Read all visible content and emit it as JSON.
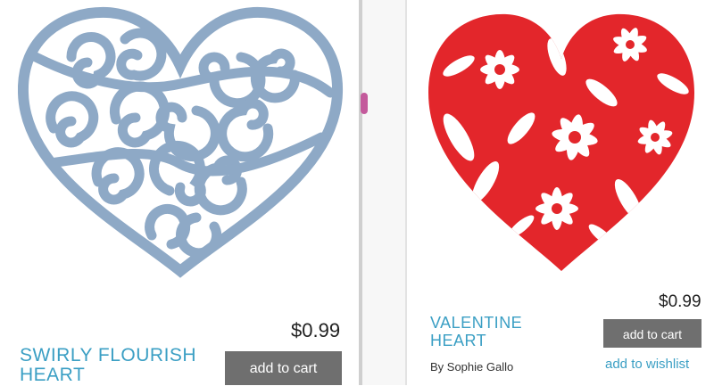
{
  "products": [
    {
      "title": "SWIRLY FLOURISH HEART",
      "price": "$0.99",
      "add_to_cart_label": "add to cart",
      "image_icon": "swirly-heart-icon",
      "color": "#8ea9c6"
    },
    {
      "title": "VALENTINE HEART",
      "price": "$0.99",
      "add_to_cart_label": "add to cart",
      "author": "By Sophie Gallo",
      "wishlist_label": "add to wishlist",
      "image_icon": "floral-heart-icon",
      "color": "#e3262b"
    }
  ],
  "colors": {
    "accent": "#3b9fc4",
    "button": "#6f6f6f"
  }
}
